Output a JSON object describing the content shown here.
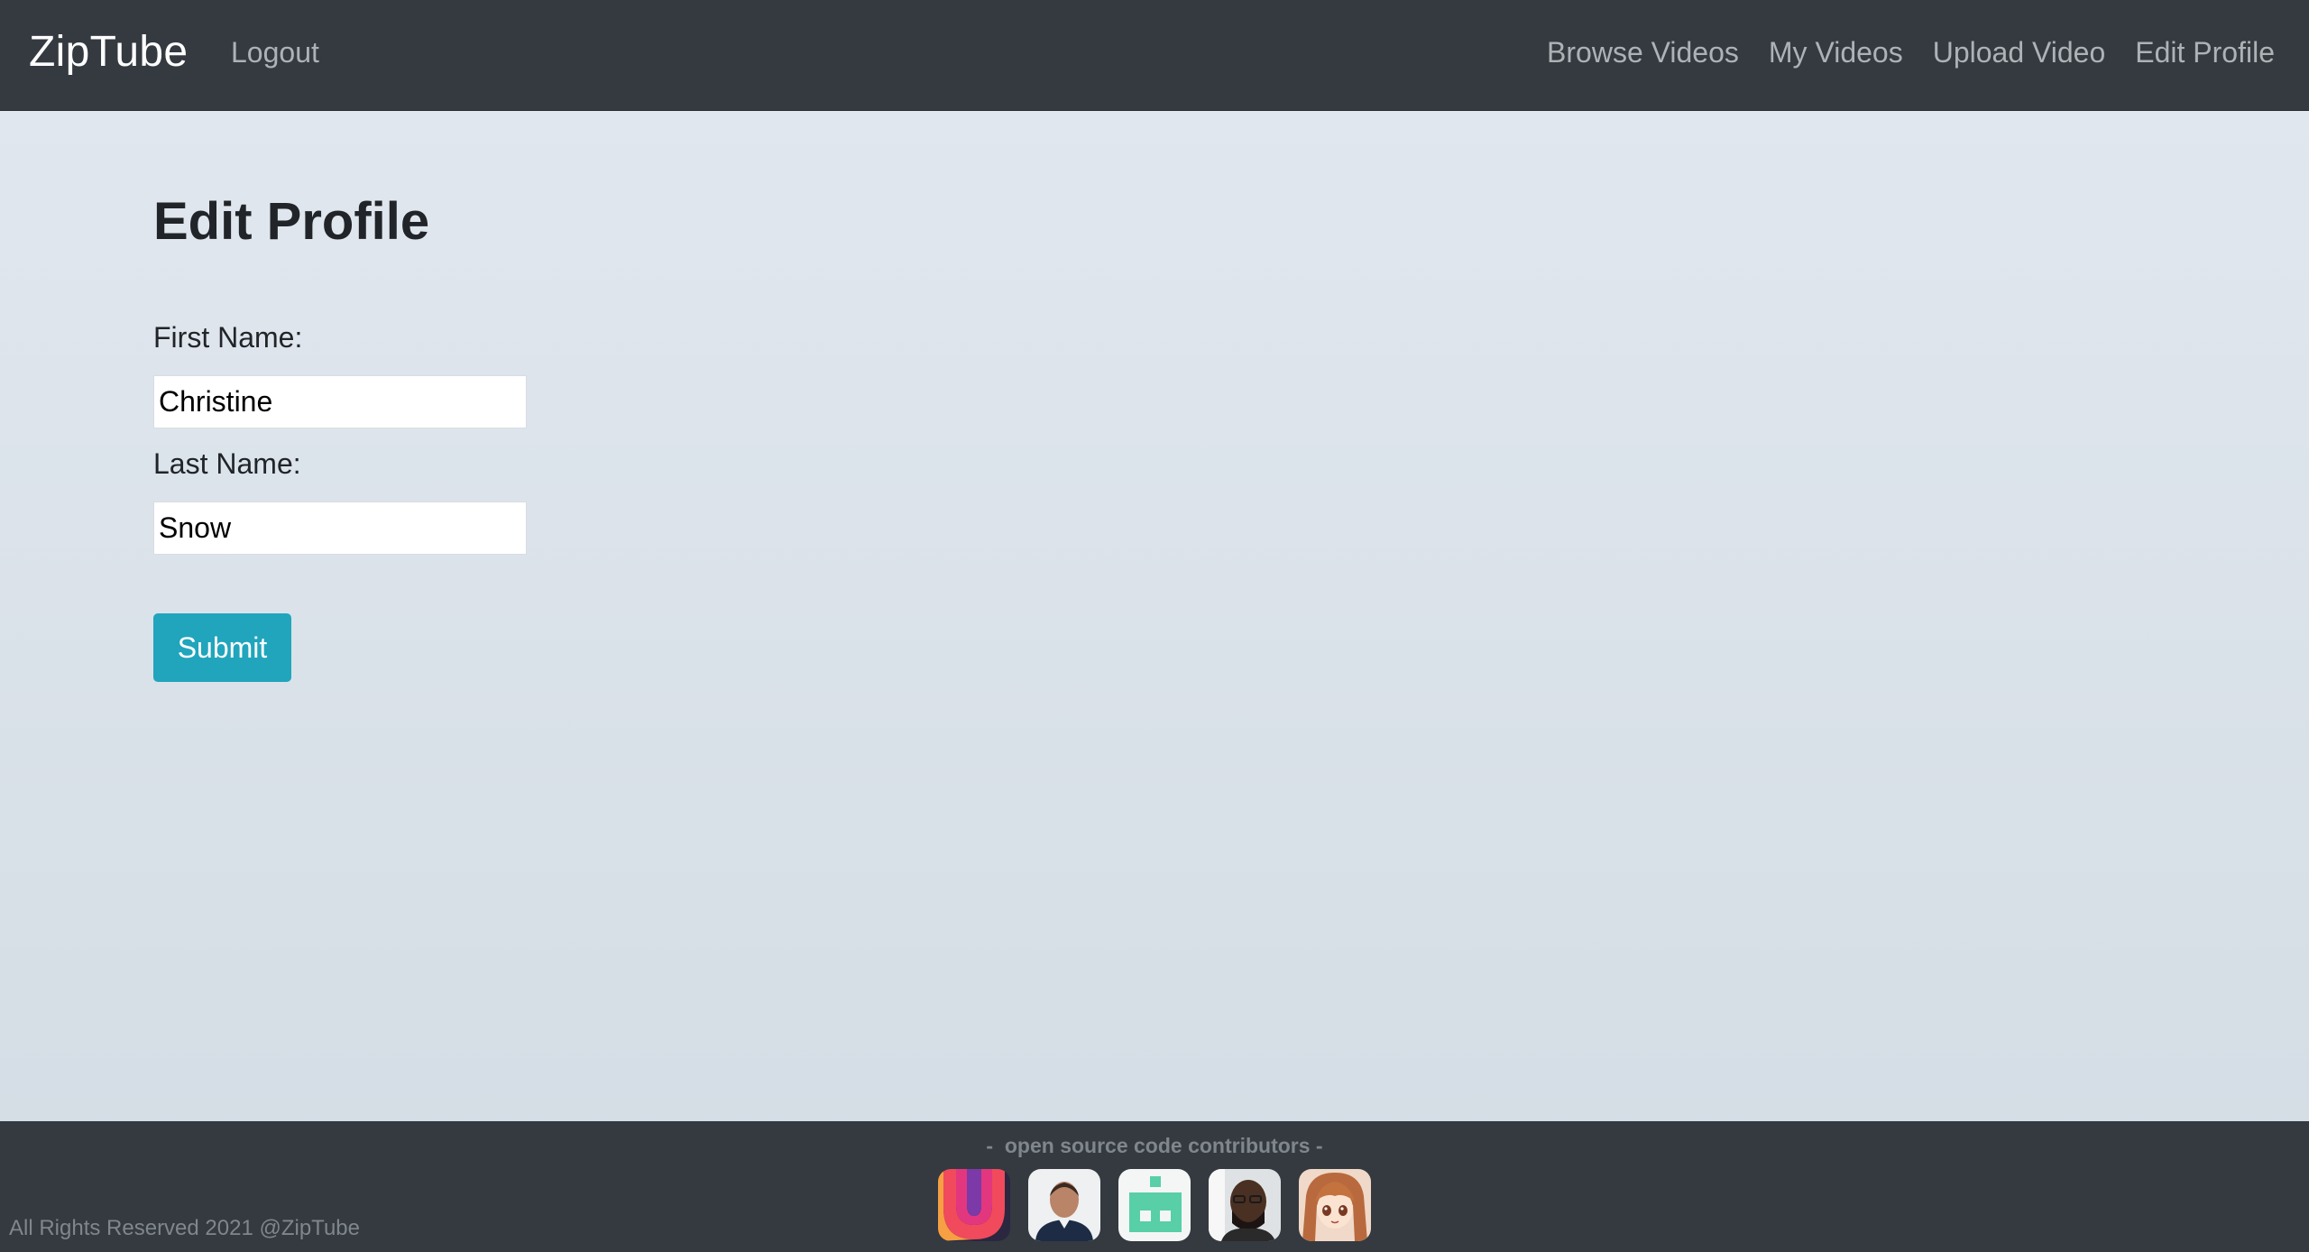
{
  "header": {
    "brand": "ZipTube",
    "logout": "Logout",
    "nav": [
      "Browse Videos",
      "My Videos",
      "Upload Video",
      "Edit Profile"
    ]
  },
  "main": {
    "title": "Edit Profile",
    "first_name_label": "First Name:",
    "first_name_value": "Christine",
    "last_name_label": "Last Name:",
    "last_name_value": "Snow",
    "submit_label": "Submit"
  },
  "footer": {
    "contributors_title": "-  open source code contributors -",
    "copyright": "All Rights Reserved 2021 @ZipTube",
    "contributors": [
      "contributor-avatar-1",
      "contributor-avatar-2",
      "contributor-avatar-3",
      "contributor-avatar-4",
      "contributor-avatar-5"
    ]
  },
  "colors": {
    "navbar_bg": "#343a40",
    "accent": "#20a5bd",
    "page_bg": "#dde4eb"
  }
}
